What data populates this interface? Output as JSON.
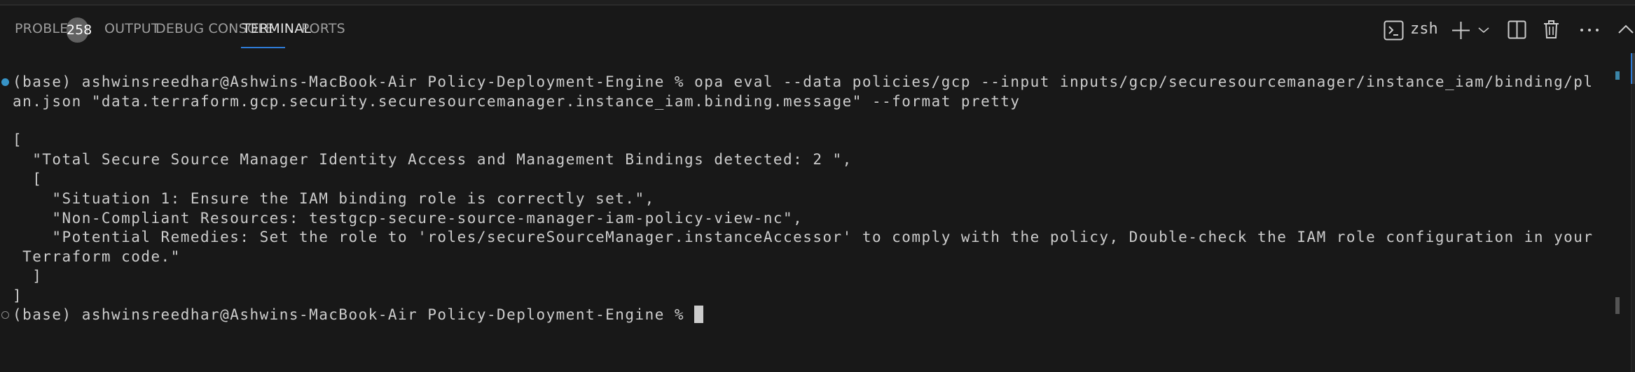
{
  "panel": {
    "tabs": [
      {
        "label": "PROBLEMS",
        "badge": "258"
      },
      {
        "label": "OUTPUT"
      },
      {
        "label": "DEBUG CONSOLE"
      },
      {
        "label": "TERMINAL",
        "active": true
      },
      {
        "label": "PORTS"
      }
    ],
    "actions": {
      "shell_label": "zsh",
      "icons": [
        "terminal-icon",
        "plus-icon",
        "chevron-down-icon",
        "split-icon",
        "trash-icon",
        "more-icon",
        "chevron-up-icon"
      ]
    }
  },
  "terminal": {
    "lines": [
      "(base) ashwinsreedhar@Ashwins-MacBook-Air Policy-Deployment-Engine % opa eval --data policies/gcp --input inputs/gcp/securesourcemanager/instance_iam/binding/pl",
      "an.json \"data.terraform.gcp.security.securesourcemanager.instance_iam.binding.message\" --format pretty",
      "",
      "[",
      "  \"Total Secure Source Manager Identity Access and Management Bindings detected: 2 \",",
      "  [",
      "    \"Situation 1: Ensure the IAM binding role is correctly set.\",",
      "    \"Non-Compliant Resources: testgcp-secure-source-manager-iam-policy-view-nc\",",
      "    \"Potential Remedies: Set the role to 'roles/secureSourceManager.instanceAccessor' to comply with the policy, Double-check the IAM role configuration in your",
      " Terraform code.\"",
      "  ]",
      "]"
    ],
    "prompt": "(base) ashwinsreedhar@Ashwins-MacBook-Air Policy-Deployment-Engine % ",
    "colors": {
      "background": "#181818",
      "text": "#cccccc",
      "success_dot": "#3794c7",
      "accent": "#2e7bd6"
    }
  }
}
